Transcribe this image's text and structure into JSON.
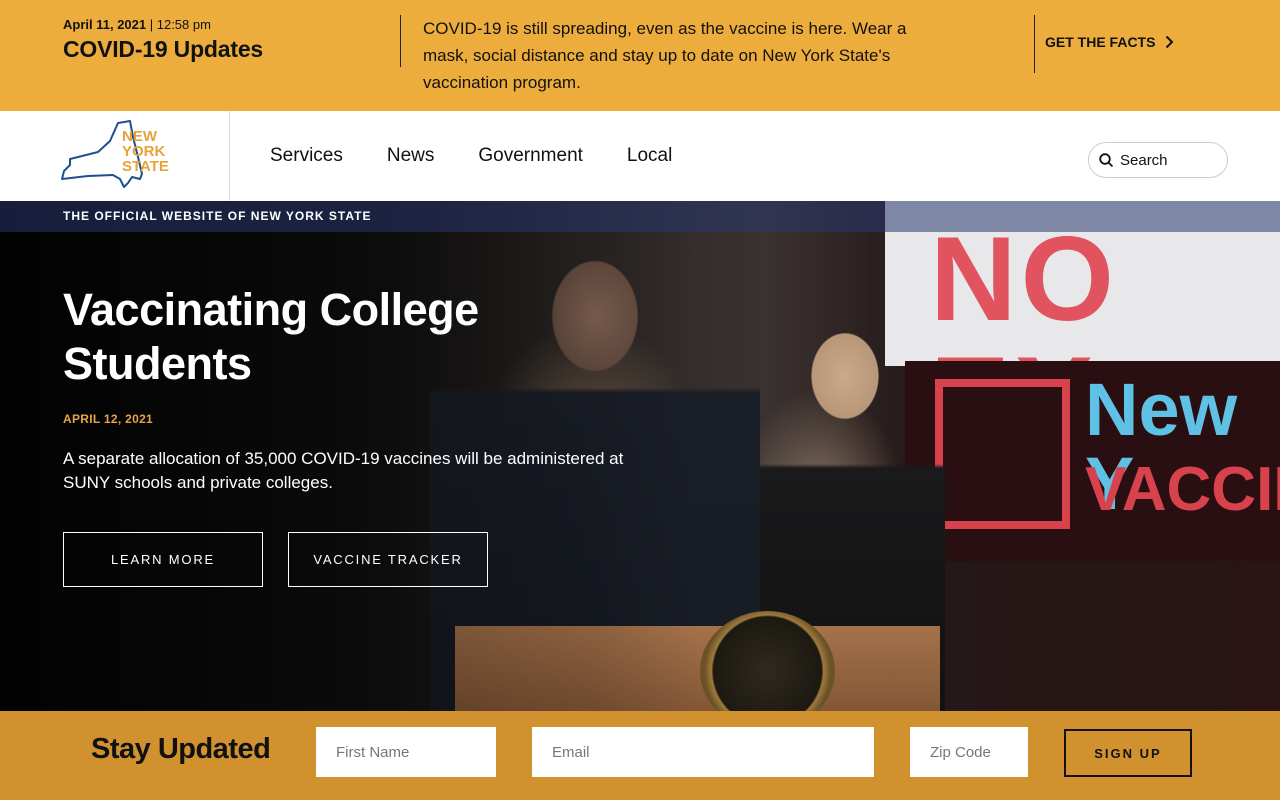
{
  "alert": {
    "date": "April 11, 2021",
    "time": "12:58 pm",
    "title": "COVID-19 Updates",
    "message": "COVID-19 is still spreading, even as the vaccine is here. Wear a mask, social distance and stay up to date on New York State's vaccination program.",
    "cta_label": "GET THE FACTS",
    "cta_icon": "chevron-right-icon"
  },
  "header": {
    "logo_lines": [
      "NEW",
      "YORK",
      "STATE"
    ],
    "nav": [
      {
        "label": "Services"
      },
      {
        "label": "News"
      },
      {
        "label": "Government"
      },
      {
        "label": "Local"
      }
    ],
    "search": {
      "placeholder": "Search",
      "icon": "search-icon"
    }
  },
  "hero": {
    "official_label": "THE OFFICIAL WEBSITE OF NEW YORK STATE",
    "title": "Vaccinating College Students",
    "date": "APRIL 12, 2021",
    "description": "A separate allocation of 35,000 COVID-19 vaccines will be administered at SUNY schools and private colleges.",
    "buttons": [
      {
        "label": "LEARN MORE"
      },
      {
        "label": "VACCINE TRACKER"
      }
    ],
    "photo_sign": {
      "line1": "NO EX",
      "line2": "New Y",
      "line3": "VACCINA"
    }
  },
  "signup": {
    "title": "Stay Updated",
    "first_name_placeholder": "First Name",
    "email_placeholder": "Email",
    "zip_placeholder": "Zip Code",
    "button_label": "SIGN UP"
  },
  "colors": {
    "alert_bg": "#edad3d",
    "signup_bg": "#d1912f",
    "hero_date": "#e8a24a",
    "logo_blue": "#1d4f91",
    "logo_orange": "#e8a23a"
  }
}
